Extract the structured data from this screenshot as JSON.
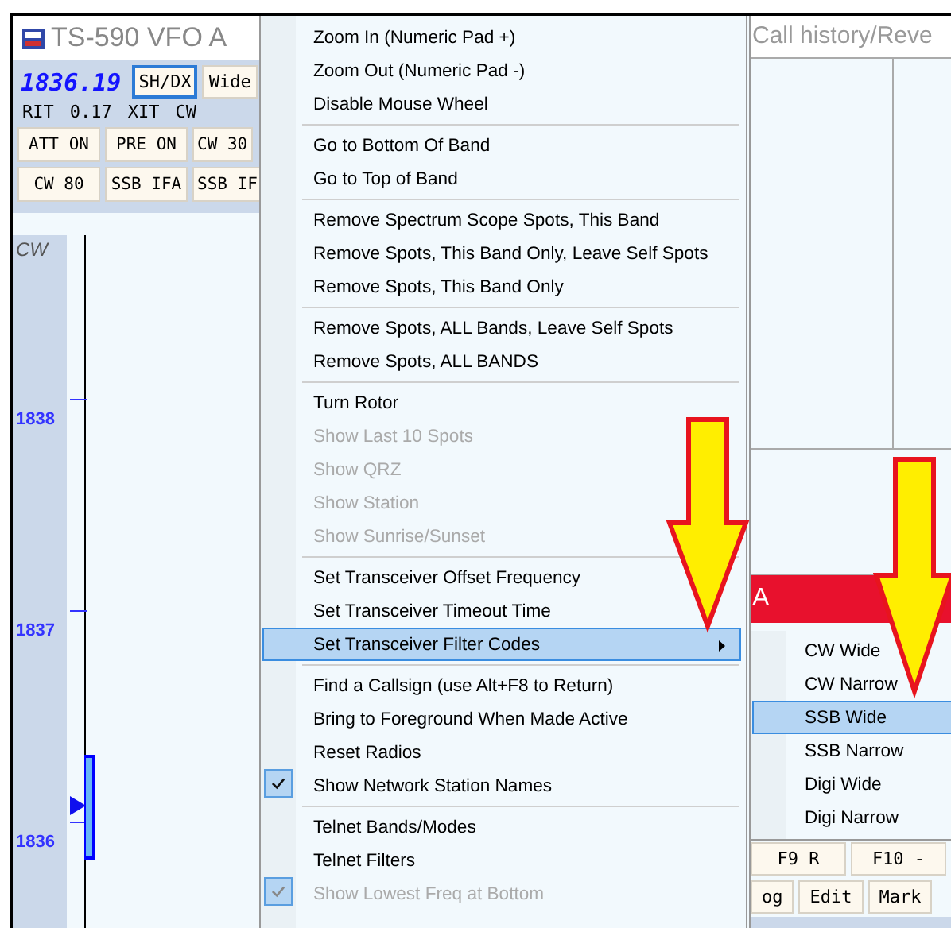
{
  "vfo_window": {
    "title": "TS-590 VFO A",
    "frequency": "1836.19",
    "top_buttons": [
      {
        "label": "SH/DX",
        "selected": true
      },
      {
        "label": "Wide",
        "selected": false
      }
    ],
    "status": [
      "RIT",
      "0.17",
      "XIT",
      "CW"
    ],
    "button_rows": [
      [
        "ATT ON",
        "PRE ON",
        "CW 30"
      ],
      [
        "CW 80",
        "SSB IFA",
        "SSB IF"
      ]
    ],
    "mode": "CW",
    "scale": [
      "1838",
      "1837",
      "1836"
    ]
  },
  "context_menu": {
    "groups": [
      [
        {
          "label": "Zoom In (Numeric Pad +)",
          "disabled": false,
          "checked": false,
          "selected": false,
          "submenu": false
        },
        {
          "label": "Zoom Out (Numeric Pad -)",
          "disabled": false,
          "checked": false,
          "selected": false,
          "submenu": false
        },
        {
          "label": "Disable Mouse Wheel",
          "disabled": false,
          "checked": false,
          "selected": false,
          "submenu": false
        }
      ],
      [
        {
          "label": "Go to Bottom Of Band",
          "disabled": false,
          "checked": false,
          "selected": false,
          "submenu": false
        },
        {
          "label": "Go to Top of Band",
          "disabled": false,
          "checked": false,
          "selected": false,
          "submenu": false
        }
      ],
      [
        {
          "label": "Remove Spectrum Scope Spots, This Band",
          "disabled": false,
          "checked": false,
          "selected": false,
          "submenu": false
        },
        {
          "label": "Remove Spots, This Band Only, Leave Self Spots",
          "disabled": false,
          "checked": false,
          "selected": false,
          "submenu": false
        },
        {
          "label": "Remove Spots, This Band Only",
          "disabled": false,
          "checked": false,
          "selected": false,
          "submenu": false
        }
      ],
      [
        {
          "label": "Remove Spots, ALL Bands, Leave Self Spots",
          "disabled": false,
          "checked": false,
          "selected": false,
          "submenu": false
        },
        {
          "label": "Remove Spots, ALL BANDS",
          "disabled": false,
          "checked": false,
          "selected": false,
          "submenu": false
        }
      ],
      [
        {
          "label": "Turn Rotor",
          "disabled": false,
          "checked": false,
          "selected": false,
          "submenu": false
        },
        {
          "label": "Show Last 10 Spots",
          "disabled": true,
          "checked": false,
          "selected": false,
          "submenu": false
        },
        {
          "label": "Show QRZ",
          "disabled": true,
          "checked": false,
          "selected": false,
          "submenu": false
        },
        {
          "label": "Show Station",
          "disabled": true,
          "checked": false,
          "selected": false,
          "submenu": false
        },
        {
          "label": "Show Sunrise/Sunset",
          "disabled": true,
          "checked": false,
          "selected": false,
          "submenu": false
        }
      ],
      [
        {
          "label": "Set Transceiver Offset Frequency",
          "disabled": false,
          "checked": false,
          "selected": false,
          "submenu": false
        },
        {
          "label": "Set Transceiver Timeout Time",
          "disabled": false,
          "checked": false,
          "selected": false,
          "submenu": false
        },
        {
          "label": "Set Transceiver Filter Codes",
          "disabled": false,
          "checked": false,
          "selected": true,
          "submenu": true
        }
      ],
      [
        {
          "label": "Find a Callsign (use Alt+F8 to Return)",
          "disabled": false,
          "checked": false,
          "selected": false,
          "submenu": false
        },
        {
          "label": "Bring to Foreground When Made Active",
          "disabled": false,
          "checked": false,
          "selected": false,
          "submenu": false
        },
        {
          "label": "Reset Radios",
          "disabled": false,
          "checked": false,
          "selected": false,
          "submenu": false
        },
        {
          "label": "Show Network Station Names",
          "disabled": false,
          "checked": true,
          "selected": false,
          "submenu": false
        }
      ],
      [
        {
          "label": "Telnet Bands/Modes",
          "disabled": false,
          "checked": false,
          "selected": false,
          "submenu": false
        },
        {
          "label": "Telnet Filters",
          "disabled": false,
          "checked": false,
          "selected": false,
          "submenu": false
        },
        {
          "label": "Show Lowest Freq at Bottom",
          "disabled": true,
          "checked": true,
          "selected": false,
          "submenu": false
        }
      ]
    ]
  },
  "call_panel": {
    "title": "Call history/Reve",
    "banner": "A",
    "button_rows": [
      [
        "F9 R",
        "F10 -"
      ],
      [
        "og",
        "Edit",
        "Mark"
      ]
    ]
  },
  "filter_submenu": {
    "items": [
      {
        "label": "CW Wide",
        "selected": false
      },
      {
        "label": "CW Narrow",
        "selected": false
      },
      {
        "label": "SSB Wide",
        "selected": true
      },
      {
        "label": "SSB Narrow",
        "selected": false
      },
      {
        "label": "Digi Wide",
        "selected": false
      },
      {
        "label": "Digi Narrow",
        "selected": false
      }
    ]
  }
}
